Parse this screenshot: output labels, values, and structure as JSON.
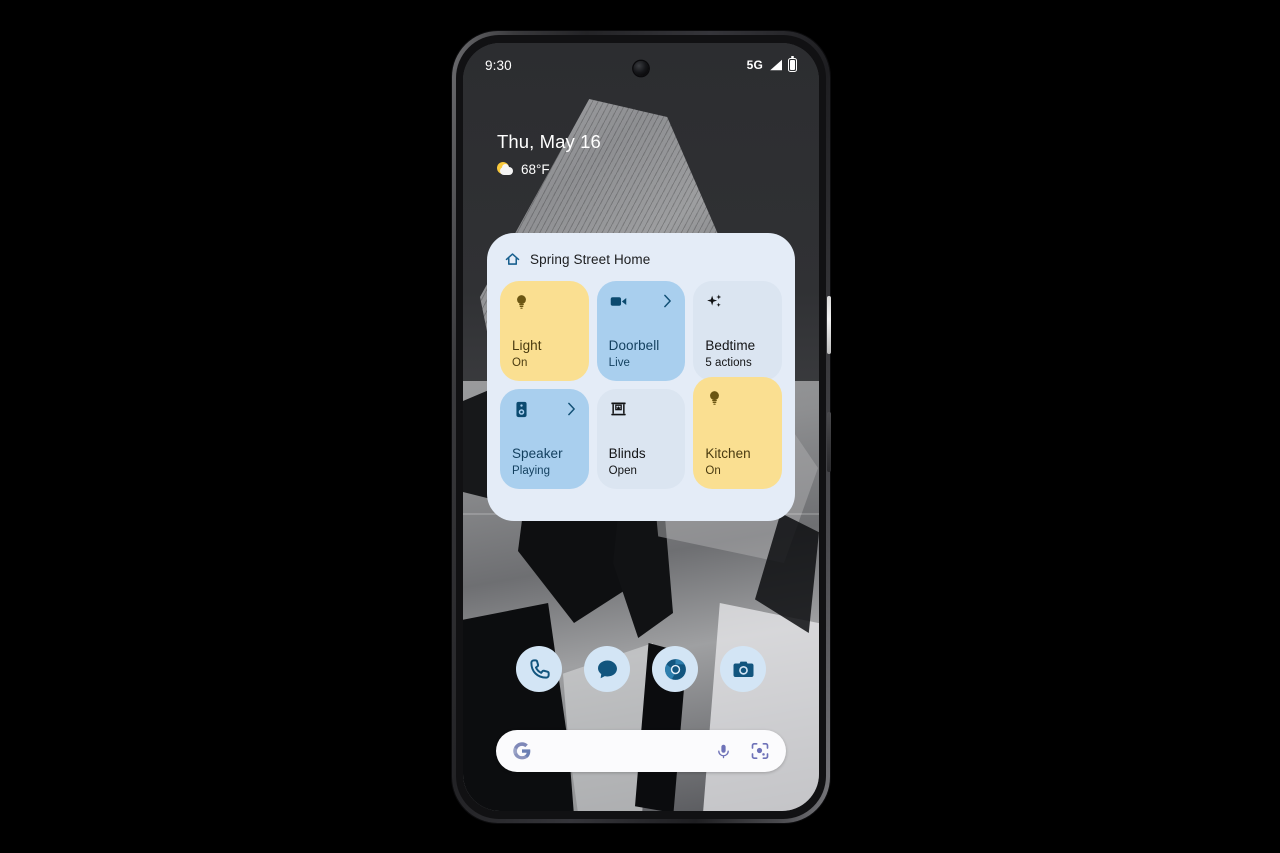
{
  "device": {
    "name": "pixel-phone",
    "status_bar": {
      "time": "9:30",
      "network": "5G",
      "signal_icon": "signal-bars-icon",
      "battery_icon": "battery-full-icon"
    }
  },
  "date_widget": {
    "date": "Thu, May 16",
    "temperature": "68°F",
    "weather_icon": "sun-behind-cloud-icon"
  },
  "home_widget": {
    "icon": "home-outline-icon",
    "title": "Spring Street Home",
    "tiles": [
      {
        "name": "light",
        "label": "Light",
        "state": "On",
        "icon": "lightbulb-icon",
        "style": "t-yellow",
        "chevron": false,
        "tall": false
      },
      {
        "name": "doorbell",
        "label": "Doorbell",
        "state": "Live",
        "icon": "videocam-icon",
        "style": "t-blue",
        "chevron": true,
        "tall": false
      },
      {
        "name": "bedtime",
        "label": "Bedtime",
        "state": "5 actions",
        "icon": "sparkle-icon",
        "style": "t-grey",
        "chevron": false,
        "tall": false
      },
      {
        "name": "speaker",
        "label": "Speaker",
        "state": "Playing",
        "icon": "speaker-icon",
        "style": "t-blue",
        "chevron": true,
        "tall": false
      },
      {
        "name": "blinds",
        "label": "Blinds",
        "state": "Open",
        "icon": "blinds-icon",
        "style": "t-grey",
        "chevron": false,
        "tall": false
      },
      {
        "name": "kitchen",
        "label": "Kitchen",
        "state": "On",
        "icon": "lightbulb-icon",
        "style": "t-yellow",
        "chevron": false,
        "tall": true
      }
    ]
  },
  "dock": {
    "apps": [
      {
        "name": "phone",
        "icon": "phone-icon"
      },
      {
        "name": "messages",
        "icon": "chat-bubble-icon"
      },
      {
        "name": "chrome",
        "icon": "chrome-icon"
      },
      {
        "name": "camera",
        "icon": "camera-icon"
      }
    ]
  },
  "search_bar": {
    "placeholder": "",
    "value": "",
    "google_icon": "google-g-icon",
    "mic_icon": "microphone-icon",
    "lens_icon": "google-lens-icon"
  },
  "colors": {
    "tile_yellow": "#fadf91",
    "tile_blue": "#a9cfee",
    "tile_grey": "#dbe5f1",
    "card_background": "#e4ecf7",
    "accent_blue": "#0b4a6f"
  }
}
